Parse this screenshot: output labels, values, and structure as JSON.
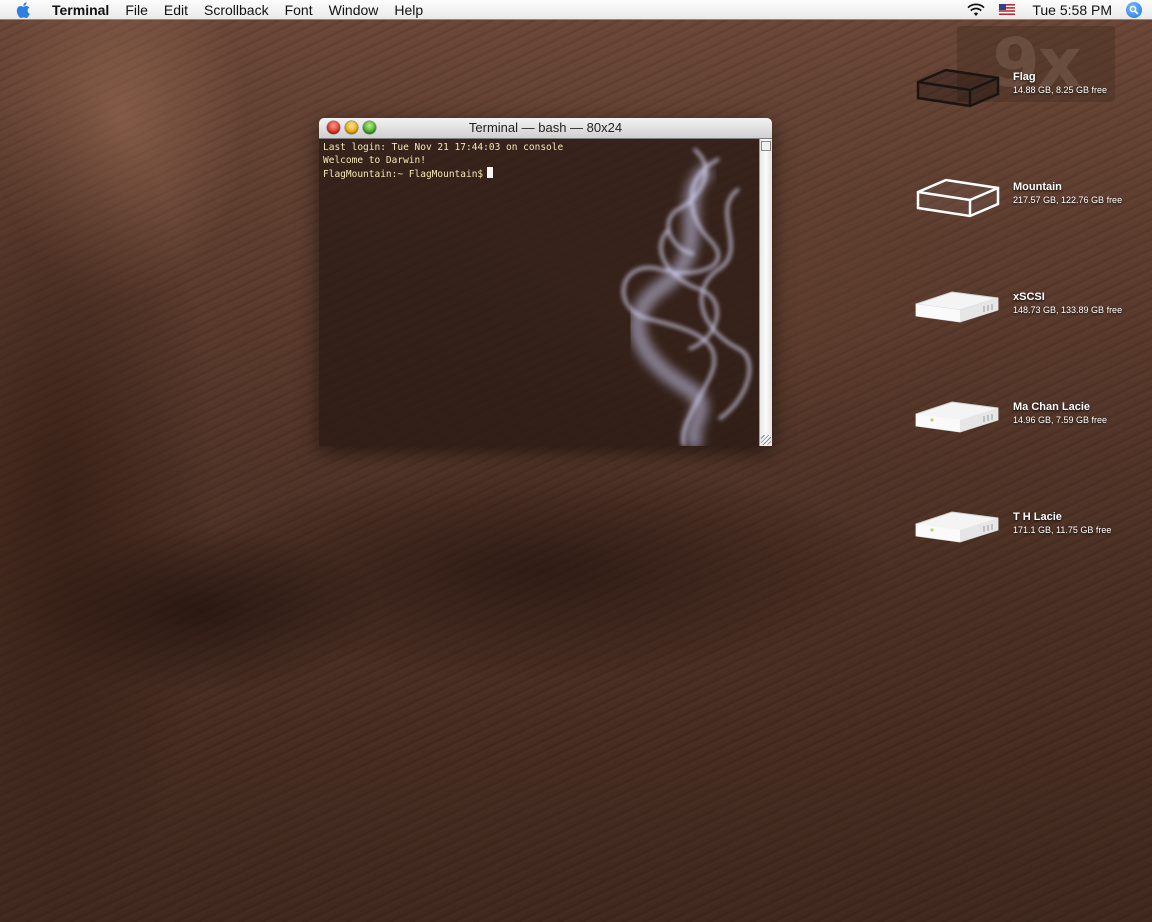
{
  "menubar": {
    "app_name": "Terminal",
    "items": [
      "File",
      "Edit",
      "Scrollback",
      "Font",
      "Window",
      "Help"
    ],
    "status": {
      "icons": [
        "apple-icon",
        "wifi-icon",
        "us-flag-icon",
        "spotlight-icon"
      ],
      "clock": "Tue 5:58 PM"
    }
  },
  "watermark": {
    "text": "9x"
  },
  "terminal": {
    "title": "Terminal — bash — 80x24",
    "lines": [
      "Last login: Tue Nov 21 17:44:03 on console",
      "Welcome to Darwin!",
      "FlagMountain:~ FlagMountain$"
    ]
  },
  "volumes": [
    {
      "name": "Flag",
      "meta": "14.88 GB, 8.25 GB free",
      "icon": "outline-drive-icon"
    },
    {
      "name": "Mountain",
      "meta": "217.57 GB, 122.76 GB free",
      "icon": "outline-drive-icon"
    },
    {
      "name": "xSCSI",
      "meta": "148.73 GB, 133.89 GB free",
      "icon": "external-drive-icon"
    },
    {
      "name": "Ma Chan Lacie",
      "meta": "14.96 GB, 7.59 GB free",
      "icon": "external-drive-icon"
    },
    {
      "name": "T H Lacie",
      "meta": "171.1 GB, 11.75 GB free",
      "icon": "external-drive-icon"
    }
  ],
  "colors": {
    "terminal_text": "#f3e8b6",
    "desktop": "#5a3a2c"
  }
}
